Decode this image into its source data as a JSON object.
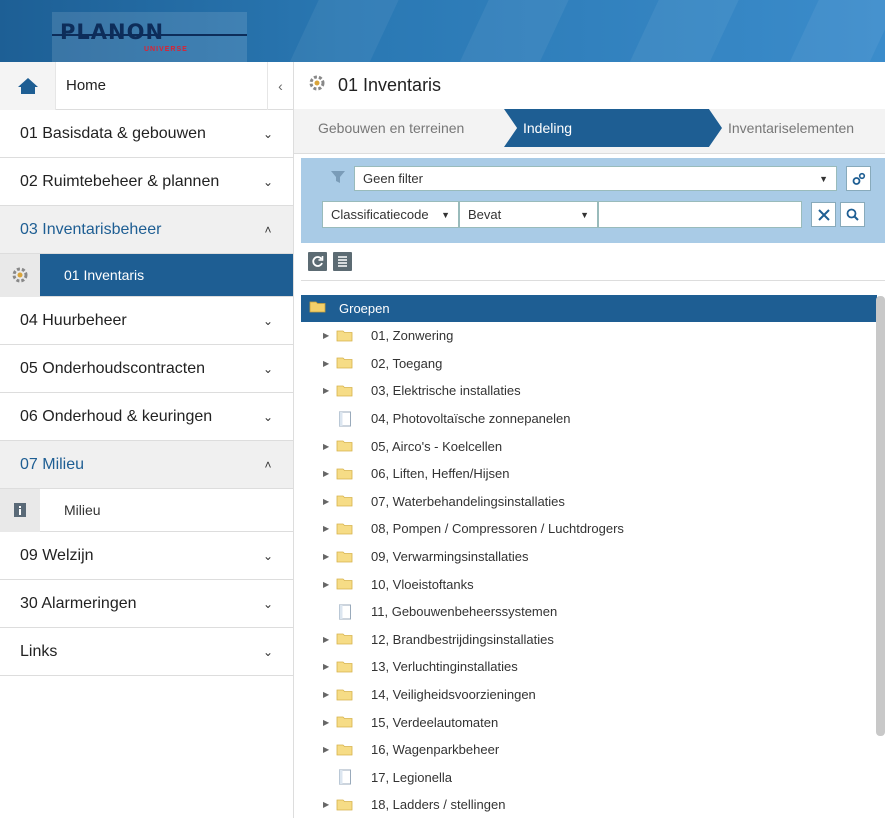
{
  "header": {
    "logo_text": "PLANON",
    "logo_sub": "UNIVERSE"
  },
  "sidebar": {
    "home_label": "Home",
    "collapse_glyph": "‹",
    "items": [
      {
        "label": "01 Basisdata & gebouwen",
        "state": "collapsed"
      },
      {
        "label": "02 Ruimtebeheer & plannen",
        "state": "collapsed"
      },
      {
        "label": "03 Inventarisbeheer",
        "state": "expanded",
        "children": [
          {
            "label": "01 Inventaris",
            "active": true
          }
        ]
      },
      {
        "label": "04 Huurbeheer",
        "state": "collapsed"
      },
      {
        "label": "05 Onderhoudscontracten",
        "state": "collapsed"
      },
      {
        "label": "06 Onderhoud & keuringen",
        "state": "collapsed"
      },
      {
        "label": "07 Milieu",
        "state": "expanded",
        "children": [
          {
            "label": "Milieu",
            "active": false
          }
        ]
      },
      {
        "label": "09 Welzijn",
        "state": "collapsed"
      },
      {
        "label": "30 Alarmeringen",
        "state": "collapsed"
      },
      {
        "label": "Links",
        "state": "collapsed"
      }
    ],
    "chevron_down": "⌄",
    "chevron_up": "˄"
  },
  "main": {
    "title": "01 Inventaris",
    "steps": [
      {
        "label": "Gebouwen en terreinen",
        "active": false
      },
      {
        "label": "Indeling",
        "active": true
      },
      {
        "label": "Inventariselementen",
        "active": false
      }
    ],
    "filter": {
      "filter_select": "Geen filter",
      "field_select": "Classificatiecode",
      "operator_select": "Bevat",
      "search_value": ""
    },
    "tree": {
      "root_label": "Groepen",
      "nodes": [
        {
          "label": "01, Zonwering",
          "type": "folder"
        },
        {
          "label": "02, Toegang",
          "type": "folder"
        },
        {
          "label": "03, Elektrische installaties",
          "type": "folder"
        },
        {
          "label": "04, Photovoltaïsche zonnepanelen",
          "type": "leaf"
        },
        {
          "label": "05, Airco's - Koelcellen",
          "type": "folder"
        },
        {
          "label": "06, Liften, Heffen/Hijsen",
          "type": "folder"
        },
        {
          "label": "07, Waterbehandelingsinstallaties",
          "type": "folder"
        },
        {
          "label": "08, Pompen / Compressoren / Luchtdrogers",
          "type": "folder"
        },
        {
          "label": "09, Verwarmingsinstallaties",
          "type": "folder"
        },
        {
          "label": "10, Vloeistoftanks",
          "type": "folder"
        },
        {
          "label": "11, Gebouwenbeheerssystemen",
          "type": "leaf"
        },
        {
          "label": "12, Brandbestrijdingsinstallaties",
          "type": "folder"
        },
        {
          "label": "13, Verluchtinginstallaties",
          "type": "folder"
        },
        {
          "label": "14, Veiligheidsvoorzieningen",
          "type": "folder"
        },
        {
          "label": "15, Verdeelautomaten",
          "type": "folder"
        },
        {
          "label": "16, Wagenparkbeheer",
          "type": "folder"
        },
        {
          "label": "17, Legionella",
          "type": "leaf"
        },
        {
          "label": "18, Ladders / stellingen",
          "type": "folder"
        }
      ]
    }
  },
  "colors": {
    "primary": "#1e5e93",
    "filter_bg": "#a9cbe6",
    "folder": "#f3d06a"
  }
}
